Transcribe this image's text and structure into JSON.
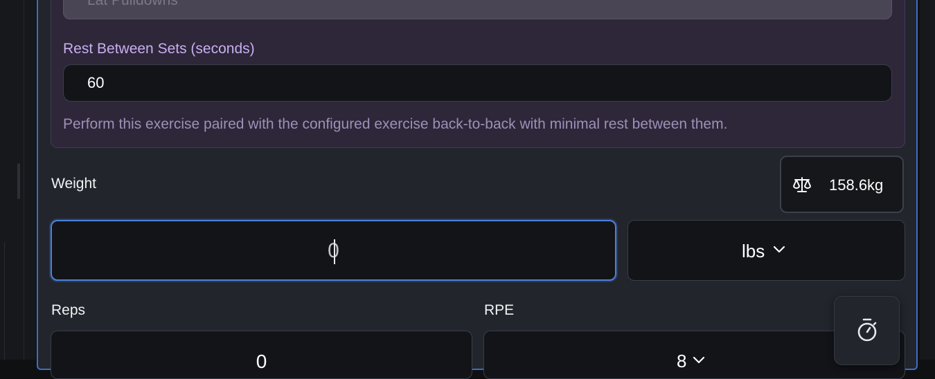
{
  "superset": {
    "exercise_value": "Lat Pulldowns",
    "rest_label": "Rest Between Sets (seconds)",
    "rest_value": "60",
    "helper_text": "Perform this exercise paired with the configured exercise back-to-back with minimal rest between them."
  },
  "weight": {
    "label": "Weight",
    "value": "0",
    "unit": "lbs",
    "scale_reading": "158.6kg",
    "scale_icon": "scale-icon",
    "unit_icon": "chevron-down-icon"
  },
  "reps": {
    "label": "Reps",
    "value": "0"
  },
  "rpe": {
    "label": "RPE",
    "value": "8",
    "icon": "chevron-down-icon"
  },
  "timer": {
    "icon": "stopwatch-icon"
  },
  "colors": {
    "accent": "#4c80dd",
    "superset_bg": "#2d2739",
    "superset_label": "#c9aef0",
    "card_bg": "#22252c",
    "input_bg": "#131418"
  }
}
